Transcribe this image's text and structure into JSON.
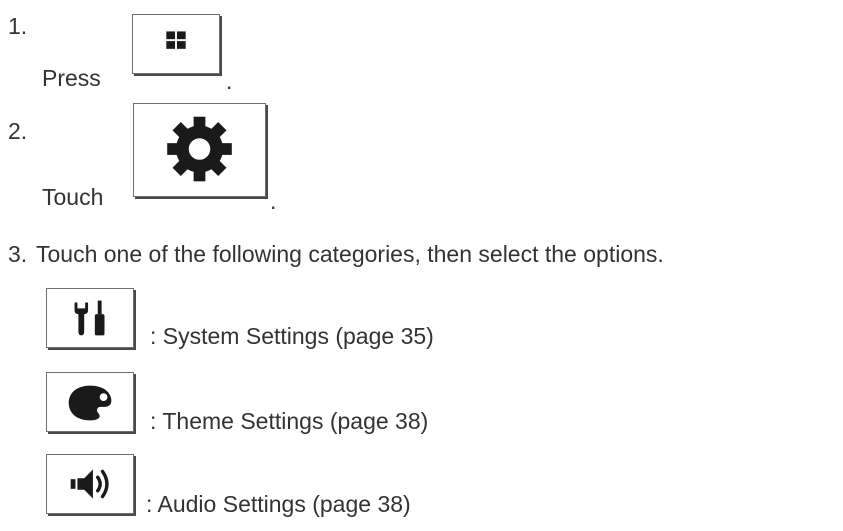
{
  "steps": [
    {
      "number": "1.",
      "text_before": "Press",
      "text_after": ".",
      "icon": "home-grid-icon"
    },
    {
      "number": "2.",
      "text_before": "Touch",
      "text_after": ".",
      "icon": "gear-icon"
    },
    {
      "number": "3.",
      "text": "Touch one of the following categories, then select the options."
    }
  ],
  "categories": [
    {
      "icon": "tools-icon",
      "label": ": System Settings (page 35)"
    },
    {
      "icon": "palette-icon",
      "label": ": Theme Settings (page 38)"
    },
    {
      "icon": "speaker-icon",
      "label": ": Audio Settings (page 38)"
    }
  ],
  "colors": {
    "text": "#333333",
    "icon": "#1a1a1a",
    "frame": "#6e6e6e"
  }
}
